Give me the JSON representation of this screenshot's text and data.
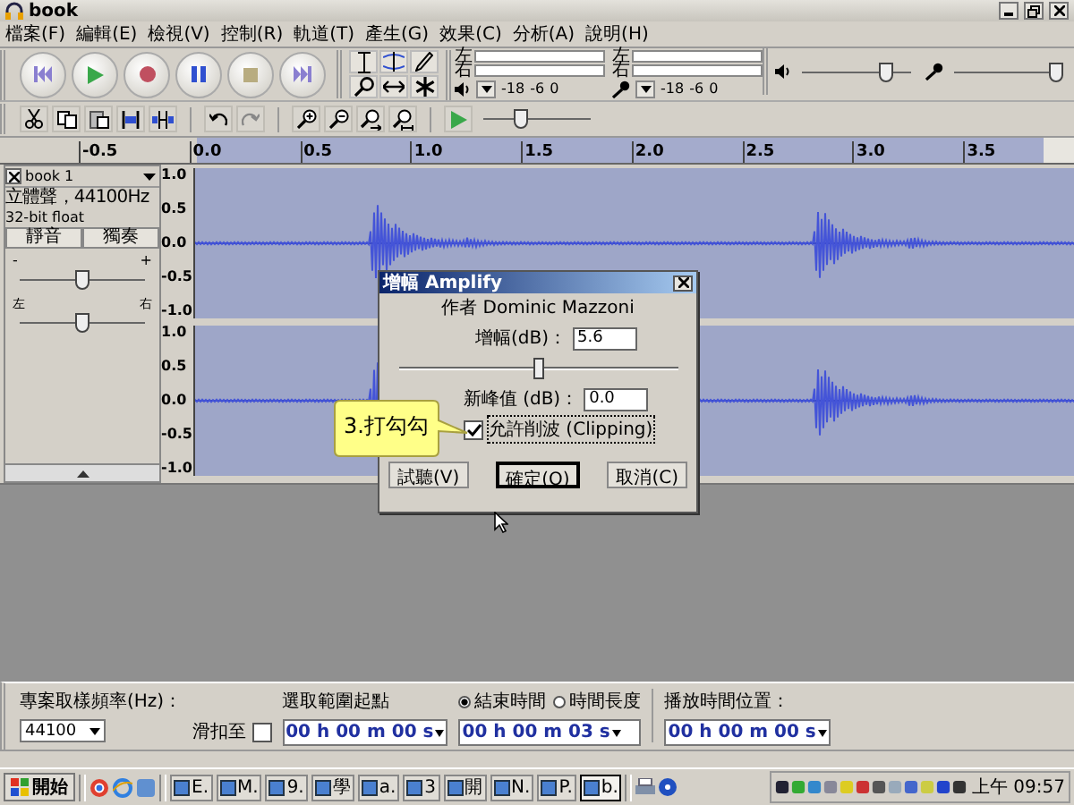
{
  "window": {
    "title": "book"
  },
  "menu": [
    "檔案(F)",
    "編輯(E)",
    "檢視(V)",
    "控制(R)",
    "軌道(T)",
    "產生(G)",
    "效果(C)",
    "分析(A)",
    "說明(H)"
  ],
  "meters": [
    {
      "kind": "playback",
      "channels": [
        "左",
        "右"
      ],
      "ticks": [
        "-18",
        "-6",
        "0"
      ]
    },
    {
      "kind": "recording",
      "channels": [
        "左",
        "右"
      ],
      "ticks": [
        "-18",
        "-6",
        "0"
      ]
    }
  ],
  "mixer": [
    {
      "kind": "output",
      "level": 0.78
    },
    {
      "kind": "input",
      "level": 0.97
    }
  ],
  "play_speed": {
    "level": 0.35
  },
  "ruler": [
    "-0.5",
    "0.0",
    "0.5",
    "1.0",
    "1.5",
    "2.0",
    "2.5",
    "3.0",
    "3.5"
  ],
  "track": {
    "name": "book 1",
    "info": "立體聲，44100Hz",
    "format": "32-bit float",
    "buttons": [
      "靜音",
      "獨奏"
    ],
    "gain": {
      "minus": "-",
      "plus": "+",
      "level": 0.5
    },
    "pan": {
      "left": "左",
      "right": "右",
      "level": 0.5
    },
    "channels": [
      {
        "scale": [
          "1.0",
          "0.5",
          "0.0",
          "-0.5",
          "-1.0"
        ]
      },
      {
        "scale": [
          "1.0",
          "0.5",
          "0.0",
          "-0.5",
          "-1.0"
        ]
      }
    ]
  },
  "dialog": {
    "title": "增幅 Amplify",
    "author": "作者 Dominic Mazzoni",
    "amplification": {
      "label": "增幅(dB)：",
      "value": "5.6"
    },
    "slider": {
      "level": 0.5
    },
    "peak": {
      "label": "新峰值 (dB)：",
      "value": "0.0"
    },
    "clipping": {
      "label": "允許削波 (Clipping)",
      "checked": true
    },
    "buttons": [
      {
        "label": "試聽(V)",
        "default": false
      },
      {
        "label": "確定(O)",
        "default": true
      },
      {
        "label": "取消(C)",
        "default": false
      }
    ]
  },
  "callout": {
    "text": "3.打勾勾"
  },
  "selection_bar": {
    "rate_label": "專案取樣頻率(Hz)：",
    "rate": "44100",
    "start_label": "選取範圍起點",
    "snap_label": "滑扣至",
    "snap_checked": false,
    "end_options": [
      {
        "label": "結束時間",
        "selected": true
      },
      {
        "label": "時間長度",
        "selected": false
      }
    ],
    "position_label": "播放時間位置：",
    "times": [
      "00 h 00 m 00 s",
      "00 h 00 m 03 s",
      "00 h 00 m 00 s"
    ]
  },
  "taskbar": {
    "start": "開始",
    "tasks": [
      {
        "label": "E.",
        "selected": false
      },
      {
        "label": "M.",
        "selected": false
      },
      {
        "label": "9.",
        "selected": false
      },
      {
        "label": "學",
        "selected": false
      },
      {
        "label": "a.",
        "selected": false
      },
      {
        "label": "3",
        "selected": false
      },
      {
        "label": "開",
        "selected": false
      },
      {
        "label": "N.",
        "selected": false
      },
      {
        "label": "P.",
        "selected": false
      },
      {
        "label": "b.",
        "selected": true
      }
    ],
    "clock": "上午 09:57"
  }
}
